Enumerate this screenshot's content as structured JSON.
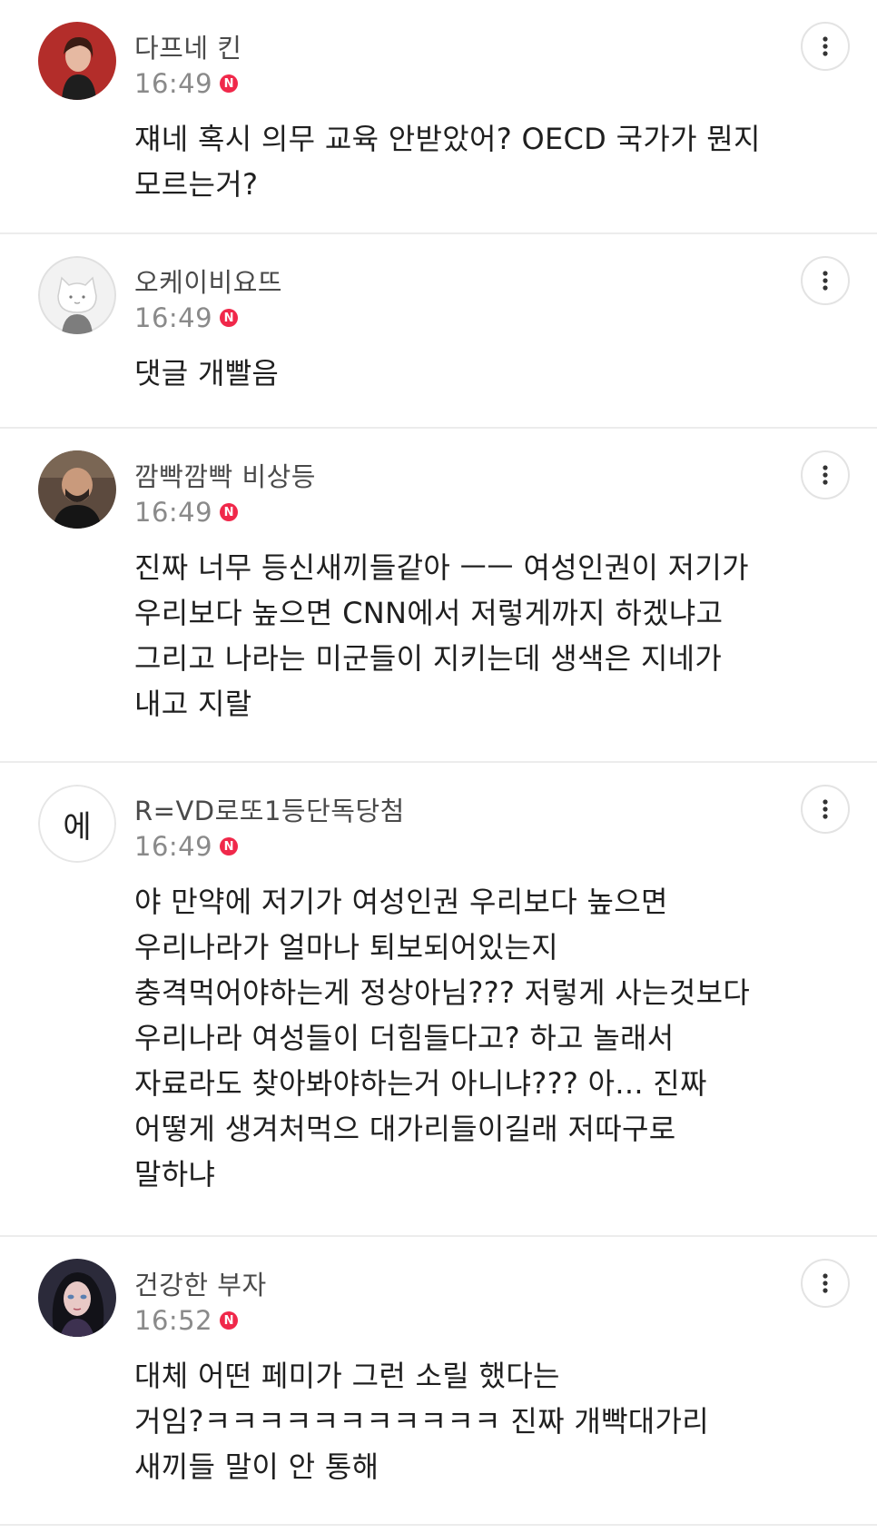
{
  "comments": [
    {
      "author": "다프네 킨",
      "time": "16:49",
      "badge": "N",
      "text": "쟤네 혹시 의무 교육 안받았어? OECD 국가가 뭔지\n모르는거?",
      "avatar_text": ""
    },
    {
      "author": "오케이비요뜨",
      "time": "16:49",
      "badge": "N",
      "text": "댓글 개빨음",
      "avatar_text": ""
    },
    {
      "author": "깜빡깜빡 비상등",
      "time": "16:49",
      "badge": "N",
      "text": "진짜 너무 등신새끼들같아 ㅡㅡ 여성인권이 저기가\n우리보다 높으면 CNN에서 저렇게까지 하겠냐고\n그리고 나라는 미군들이 지키는데 생색은 지네가\n내고 지랄",
      "avatar_text": ""
    },
    {
      "author": "R=VD로또1등단독당첨",
      "time": "16:49",
      "badge": "N",
      "text": "야 만약에 저기가 여성인권 우리보다 높으면\n우리나라가 얼마나 퇴보되어있는지\n충격먹어야하는게 정상아님??? 저렇게 사는것보다\n우리나라 여성들이 더힘들다고? 하고 놀래서\n자료라도 찾아봐야하는거 아니냐??? 아... 진짜\n어떻게 생겨처먹으 대가리들이길래 저따구로\n말하냐",
      "avatar_text": "에"
    },
    {
      "author": "건강한 부자",
      "time": "16:52",
      "badge": "N",
      "text": "대체 어떤 페미가 그런 소릴 했다는\n거임?ㅋㅋㅋㅋㅋㅋㅋㅋㅋㅋㅋ 진짜 개빡대가리\n새끼들 말이 안 통해",
      "avatar_text": ""
    }
  ],
  "icons": {
    "more": "more-vertical-icon",
    "badge": "new-badge-icon"
  },
  "colors": {
    "badge": "#f0284a",
    "text": "#1f1f1f",
    "author": "#4a4a4a",
    "time": "#8a8a8a",
    "divider": "#ececec"
  }
}
